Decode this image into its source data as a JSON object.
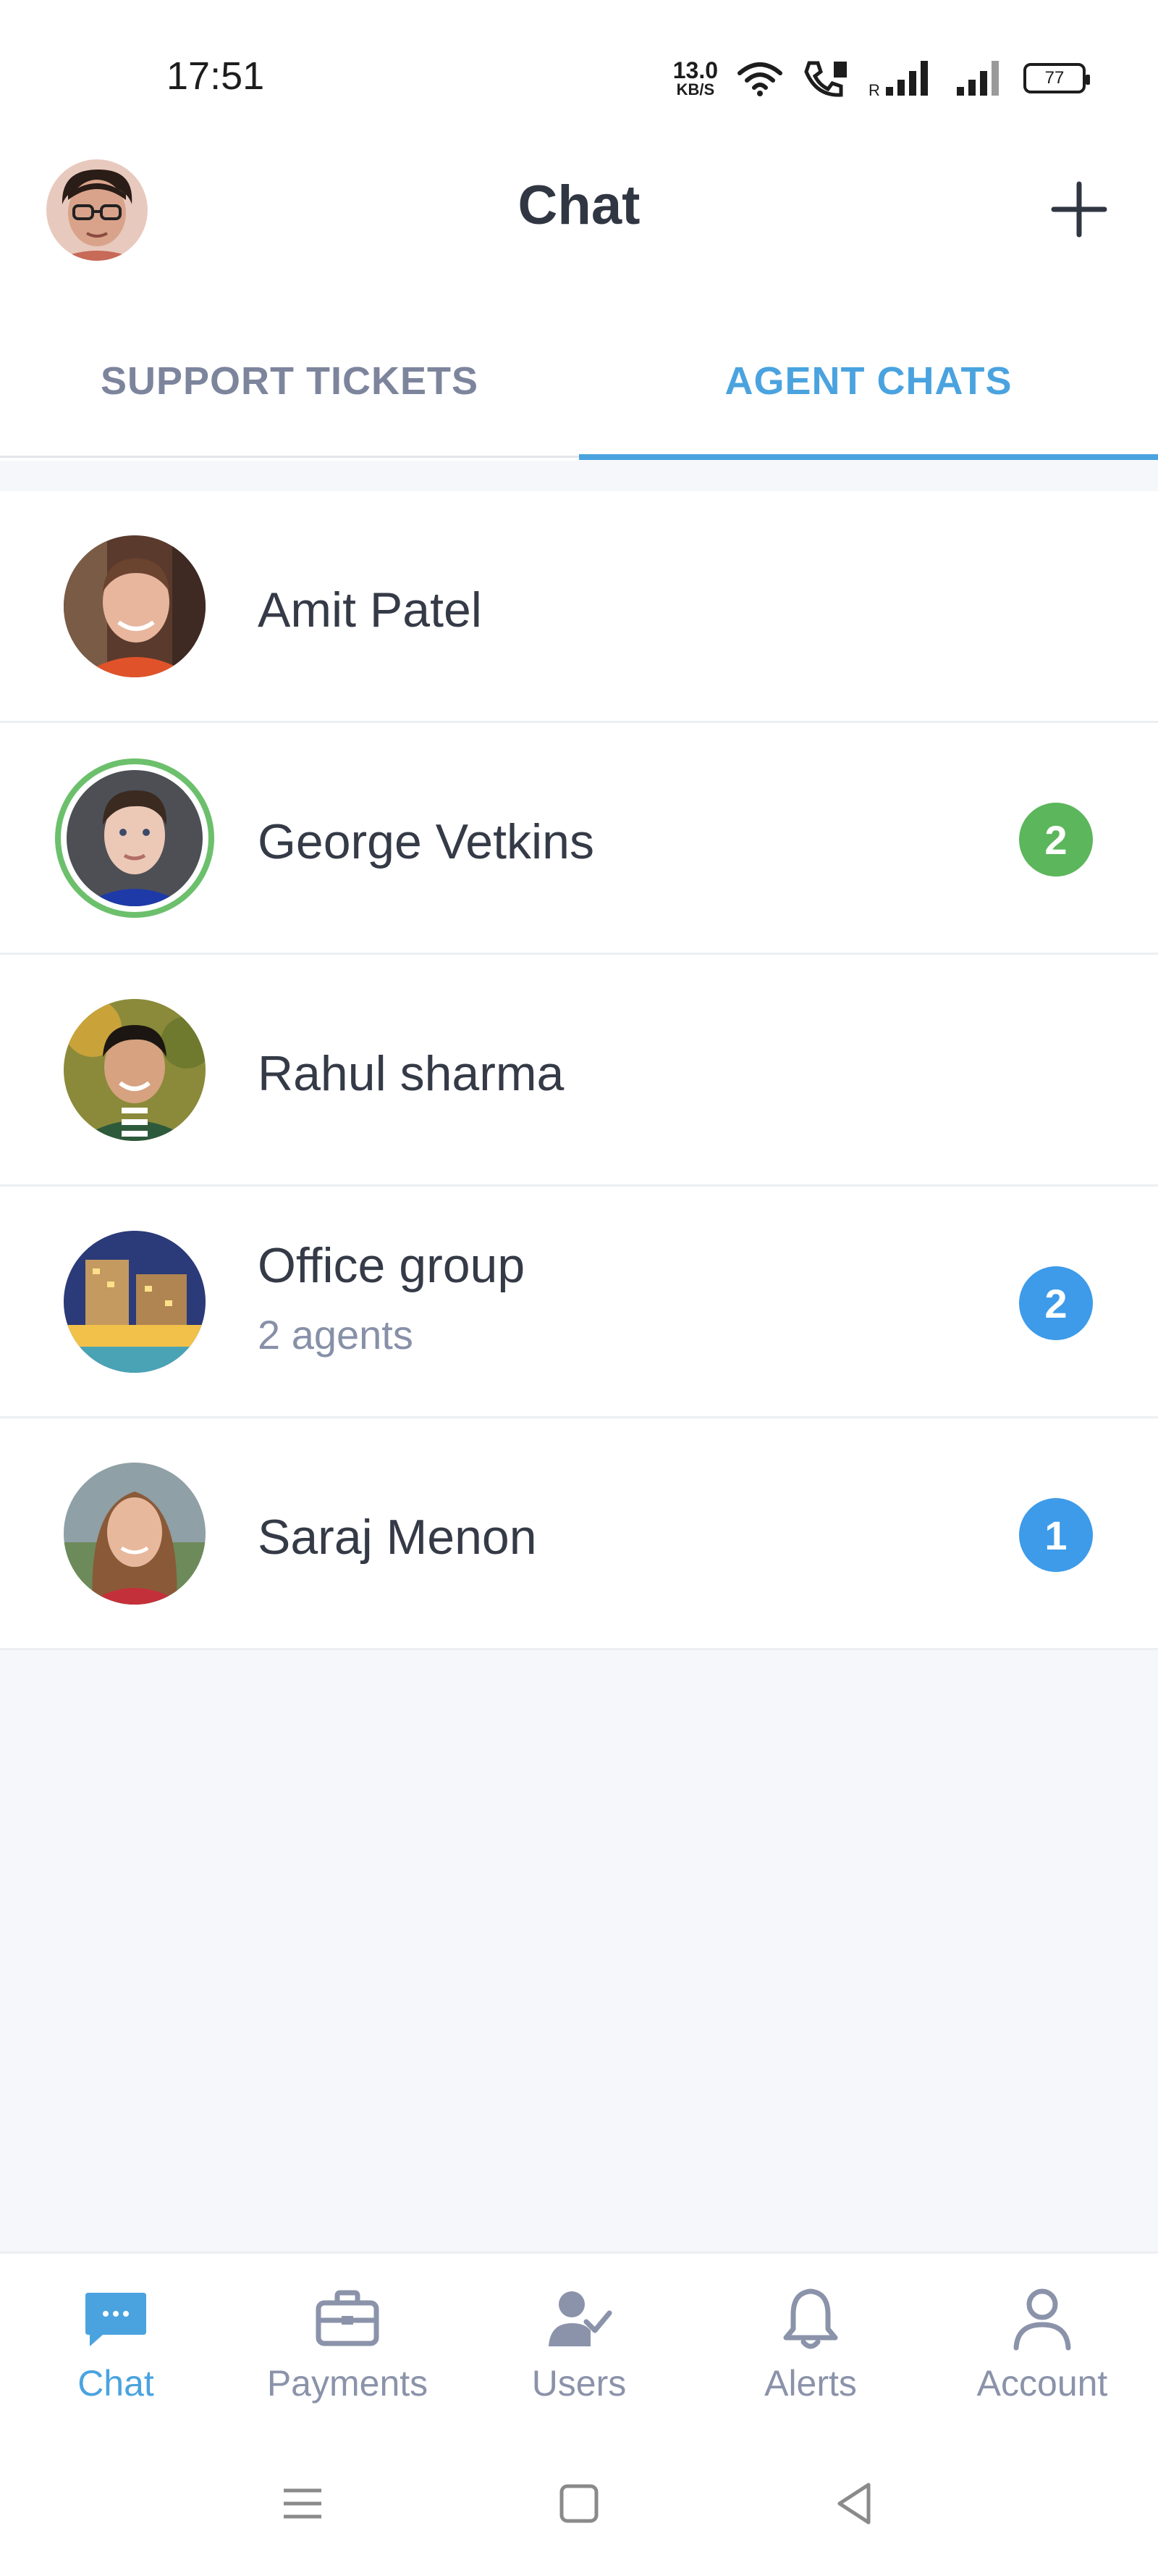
{
  "status_bar": {
    "time": "17:51",
    "net_speed_value": "13.0",
    "net_speed_unit": "KB/S",
    "battery": "77"
  },
  "header": {
    "title": "Chat",
    "avatar_icon": "user-avatar",
    "add_icon": "plus-icon"
  },
  "tabs": [
    {
      "label": "SUPPORT TICKETS",
      "active": false
    },
    {
      "label": "AGENT CHATS",
      "active": true
    }
  ],
  "chats": [
    {
      "name": "Amit Patel",
      "subtitle": "",
      "badge": "",
      "online": false
    },
    {
      "name": "George Vetkins",
      "subtitle": "",
      "badge": "2",
      "badge_color": "#5cb65c",
      "online": true
    },
    {
      "name": "Rahul sharma",
      "subtitle": "",
      "badge": "",
      "online": false
    },
    {
      "name": "Office group",
      "subtitle": "2 agents",
      "badge": "2",
      "badge_color": "#3d9be9",
      "online": false
    },
    {
      "name": "Saraj Menon",
      "subtitle": "",
      "badge": "1",
      "badge_color": "#3d9be9",
      "online": false
    }
  ],
  "bottom_nav": [
    {
      "label": "Chat",
      "icon": "chat-bubble-icon",
      "active": true
    },
    {
      "label": "Payments",
      "icon": "briefcase-icon",
      "active": false
    },
    {
      "label": "Users",
      "icon": "user-check-icon",
      "active": false
    },
    {
      "label": "Alerts",
      "icon": "bell-icon",
      "active": false
    },
    {
      "label": "Account",
      "icon": "person-icon",
      "active": false
    }
  ],
  "colors": {
    "accent": "#4aa3df",
    "online": "#6cc06c",
    "badge_green": "#5cb65c",
    "badge_blue": "#3d9be9",
    "muted": "#8b93aa"
  }
}
